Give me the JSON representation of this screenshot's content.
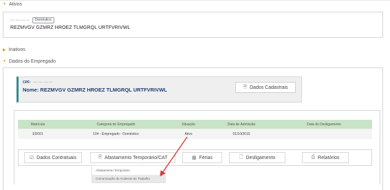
{
  "sections": {
    "ativos": "Ativos",
    "inativos": "Inativos",
    "dados_empregado": "Dados do Empregado"
  },
  "ativos_box": {
    "cpf_masked": "•••.•••.•••-••",
    "tag": "Doméstico",
    "name": "REZMVGV GZMRZ HROEZ TLMGRQL URTFVRIVWL"
  },
  "employee_card": {
    "cpf_label": "CPF:",
    "cpf_masked": "•••.•••.•••-••",
    "nome_label": "Nome: REZMVGV GZMRZ HROEZ TLMGRQL URTFVRIVWL",
    "dados_cadastrais": "Dados Cadastrais"
  },
  "table": {
    "headers": [
      "Matrícula",
      "Categoria do Empregado",
      "Situação",
      "Data de Admissão",
      "Data do Desligamento"
    ],
    "rows": [
      [
        "ED001",
        "104 - Empregado - Doméstico",
        "Ativo",
        "01/10/2015",
        ""
      ]
    ]
  },
  "actions": {
    "dados_contratuais": "Dados Contratuais",
    "afastamento": "Afastamento Temporário/CAT",
    "ferias": "Férias",
    "desligamento": "Desligamento",
    "relatorios": "Relatórios"
  },
  "dropdown": {
    "items": [
      "Afastamento Temporário",
      "Comunicação de Acidente de Trabalho"
    ]
  },
  "colors": {
    "accent_orange": "#e69a2e",
    "header_green": "#c9e3c7",
    "card_accent": "#2d8a93",
    "name_blue": "#1e3f70",
    "arrow_red": "#d93a3a"
  }
}
